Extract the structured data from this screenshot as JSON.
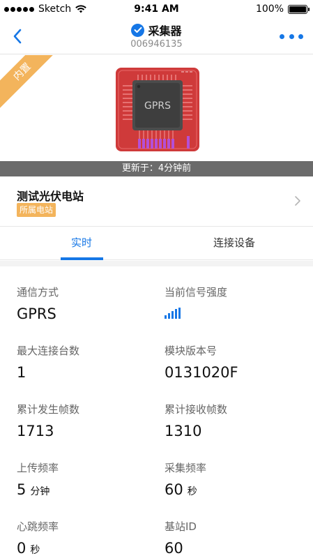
{
  "status_bar": {
    "carrier": "Sketch",
    "time": "9:41 AM",
    "battery": "100%"
  },
  "nav": {
    "title": "采集器",
    "serial": "006946135"
  },
  "hero": {
    "ribbon": "内置",
    "chip_label": "GPRS"
  },
  "update": {
    "text": "更新于：4分钟前"
  },
  "station": {
    "name": "测试光伏电站",
    "tag": "所属电站"
  },
  "tabs": [
    {
      "label": "实时"
    },
    {
      "label": "连接设备"
    }
  ],
  "fields": {
    "comm_method": {
      "label": "通信方式",
      "value": "GPRS"
    },
    "signal": {
      "label": "当前信号强度",
      "level": 5,
      "max": 5
    },
    "max_devices": {
      "label": "最大连接台数",
      "value": "1"
    },
    "module_version": {
      "label": "模块版本号",
      "value": "0131020F"
    },
    "sent_frames": {
      "label": "累计发生帧数",
      "value": "1713"
    },
    "recv_frames": {
      "label": "累计接收帧数",
      "value": "1310"
    },
    "upload_freq": {
      "label": "上传频率",
      "value": "5",
      "unit": "分钟"
    },
    "collect_freq": {
      "label": "采集频率",
      "value": "60",
      "unit": "秒"
    },
    "heartbeat_freq": {
      "label": "心跳频率",
      "value": "0",
      "unit": "秒"
    },
    "base_station_id": {
      "label": "基站ID",
      "value": "60"
    }
  },
  "colors": {
    "accent": "#1677e6",
    "tag": "#f3b45c",
    "chip_board": "#cf3a3a",
    "pins": "#b44fd6"
  }
}
